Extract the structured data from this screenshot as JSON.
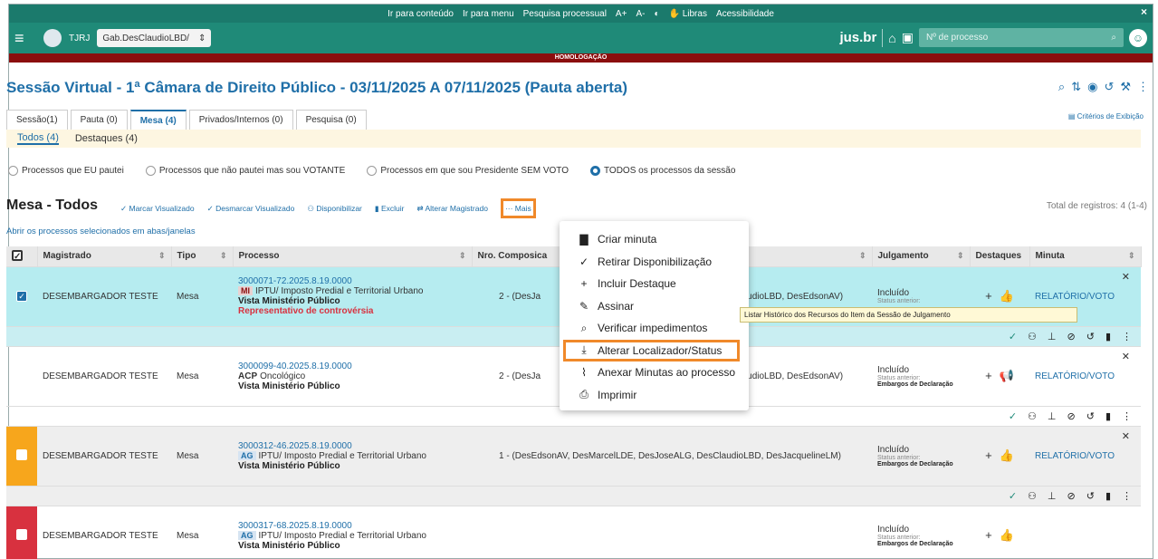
{
  "accessibility_bar": {
    "links": [
      "Ir para conteúdo",
      "Ir para menu",
      "Pesquisa processual",
      "A+",
      "A-",
      "◐",
      "✋ Libras",
      "Acessibilidade"
    ],
    "close": "×"
  },
  "top_bar": {
    "org": "TJRJ",
    "org_select": "Gab.DesClaudioLBD/",
    "brand": "jus.br",
    "process_placeholder": "Nº de processo"
  },
  "env_banner": "HOMOLOGAÇÃO",
  "page_title": "Sessão Virtual - 1ª Câmara de Direito Público - 03/11/2025 A 07/11/2025 (Pauta aberta)",
  "tabs": [
    {
      "label": "Sessão(1)",
      "active": false
    },
    {
      "label": "Pauta (0)",
      "active": false
    },
    {
      "label": "Mesa (4)",
      "active": true
    },
    {
      "label": "Privados/Internos (0)",
      "active": false
    },
    {
      "label": "Pesquisa (0)",
      "active": false
    }
  ],
  "criteria_link": "Critérios de Exibição",
  "subtabs": [
    {
      "label": "Todos (4)",
      "active": true
    },
    {
      "label": "Destaques (4)",
      "active": false
    }
  ],
  "filters": [
    {
      "label": "Processos que EU pautei",
      "selected": false
    },
    {
      "label": "Processos que não pautei mas sou VOTANTE",
      "selected": false
    },
    {
      "label": "Processos em que sou Presidente SEM VOTO",
      "selected": false
    },
    {
      "label": "TODOS os processos da sessão",
      "selected": true
    }
  ],
  "section_title": "Mesa - Todos",
  "toolbar": {
    "marcar": "Marcar Visualizado",
    "desmarcar": "Desmarcar Visualizado",
    "disponibilizar": "Disponibilizar",
    "excluir": "Excluir",
    "alterar_magistrado": "Alterar Magistrado",
    "mais": "Mais"
  },
  "total_records": "Total de registros: 4 (1-4)",
  "open_selected": "Abrir os processos selecionados em abas/janelas",
  "table": {
    "headers": {
      "magistrado": "Magistrado",
      "tipo": "Tipo",
      "processo": "Processo",
      "composicao": "Nro. Composica",
      "julgamento": "Julgamento",
      "destaques": "Destaques",
      "minuta": "Minuta"
    },
    "rows": [
      {
        "magistrado": "DESEMBARGADOR TESTE",
        "tipo": "Mesa",
        "numero": "3000071-72.2025.8.19.0000",
        "classe": "MI",
        "assunto": "IPTU/ Imposto Predial e Territorial Urbano",
        "vista": "Vista Ministério Público",
        "extra": "Representativo de controvérsia",
        "composicao": "2 - (DesJa",
        "composicao_tail": "sClaudioLBD, DesEdsonAV)",
        "julgamento": "Incluído",
        "status_label": "Status anterior:",
        "status_value": "",
        "minuta": "RELATÓRIO/VOTO",
        "selected": true
      },
      {
        "magistrado": "DESEMBARGADOR TESTE",
        "tipo": "Mesa",
        "numero": "3000099-40.2025.8.19.0000",
        "classe": "ACP",
        "assunto": "Oncológico",
        "vista": "Vista Ministério Público",
        "extra": "",
        "composicao": "2 - (DesJa",
        "composicao_tail": "sClaudioLBD, DesEdsonAV)",
        "julgamento": "Incluído",
        "status_label": "Status anterior:",
        "status_value": "Embargos de Declaração",
        "minuta": "RELATÓRIO/VOTO",
        "selected": false
      },
      {
        "magistrado": "DESEMBARGADOR TESTE",
        "tipo": "Mesa",
        "numero": "3000312-46.2025.8.19.0000",
        "classe": "AG",
        "assunto": "IPTU/ Imposto Predial e Territorial Urbano",
        "vista": "Vista Ministério Público",
        "extra": "",
        "composicao": "1 - (DesEdsonAV, DesMarcelLDE, DesJoseALG, DesClaudioLBD, DesJacquelineLM)",
        "composicao_tail": "",
        "julgamento": "Incluído",
        "status_label": "Status anterior:",
        "status_value": "Embargos de Declaração",
        "minuta": "RELATÓRIO/VOTO",
        "selected": false
      },
      {
        "magistrado": "DESEMBARGADOR TESTE",
        "tipo": "Mesa",
        "numero": "3000317-68.2025.8.19.0000",
        "classe": "AG",
        "assunto": "IPTU/ Imposto Predial e Territorial Urbano",
        "vista": "Vista Ministério Público",
        "extra": "",
        "composicao": "",
        "composicao_tail": "",
        "julgamento": "Incluído",
        "status_label": "Status anterior:",
        "status_value": "Embargos de Declaração",
        "minuta": "",
        "selected": false
      }
    ]
  },
  "menu": [
    {
      "label": "Criar minuta",
      "icon": "file-icon"
    },
    {
      "label": "Retirar Disponibilização",
      "icon": "check-icon"
    },
    {
      "label": "Incluir Destaque",
      "icon": "plus-icon"
    },
    {
      "label": "Assinar",
      "icon": "pen-icon"
    },
    {
      "label": "Verificar impedimentos",
      "icon": "search-person-icon"
    },
    {
      "label": "Alterar Localizador/Status",
      "icon": "download-icon",
      "highlighted": true
    },
    {
      "label": "Anexar Minutas ao processo",
      "icon": "paperclip-icon"
    },
    {
      "label": "Imprimir",
      "icon": "print-icon"
    }
  ],
  "tooltip": "Listar Histórico dos Recursos do Item da Sessão de Julgamento",
  "colors": {
    "brand": "#1f8a78",
    "link": "#1f6fa8",
    "highlight": "#f0892a",
    "banner": "#8b0e0e"
  }
}
